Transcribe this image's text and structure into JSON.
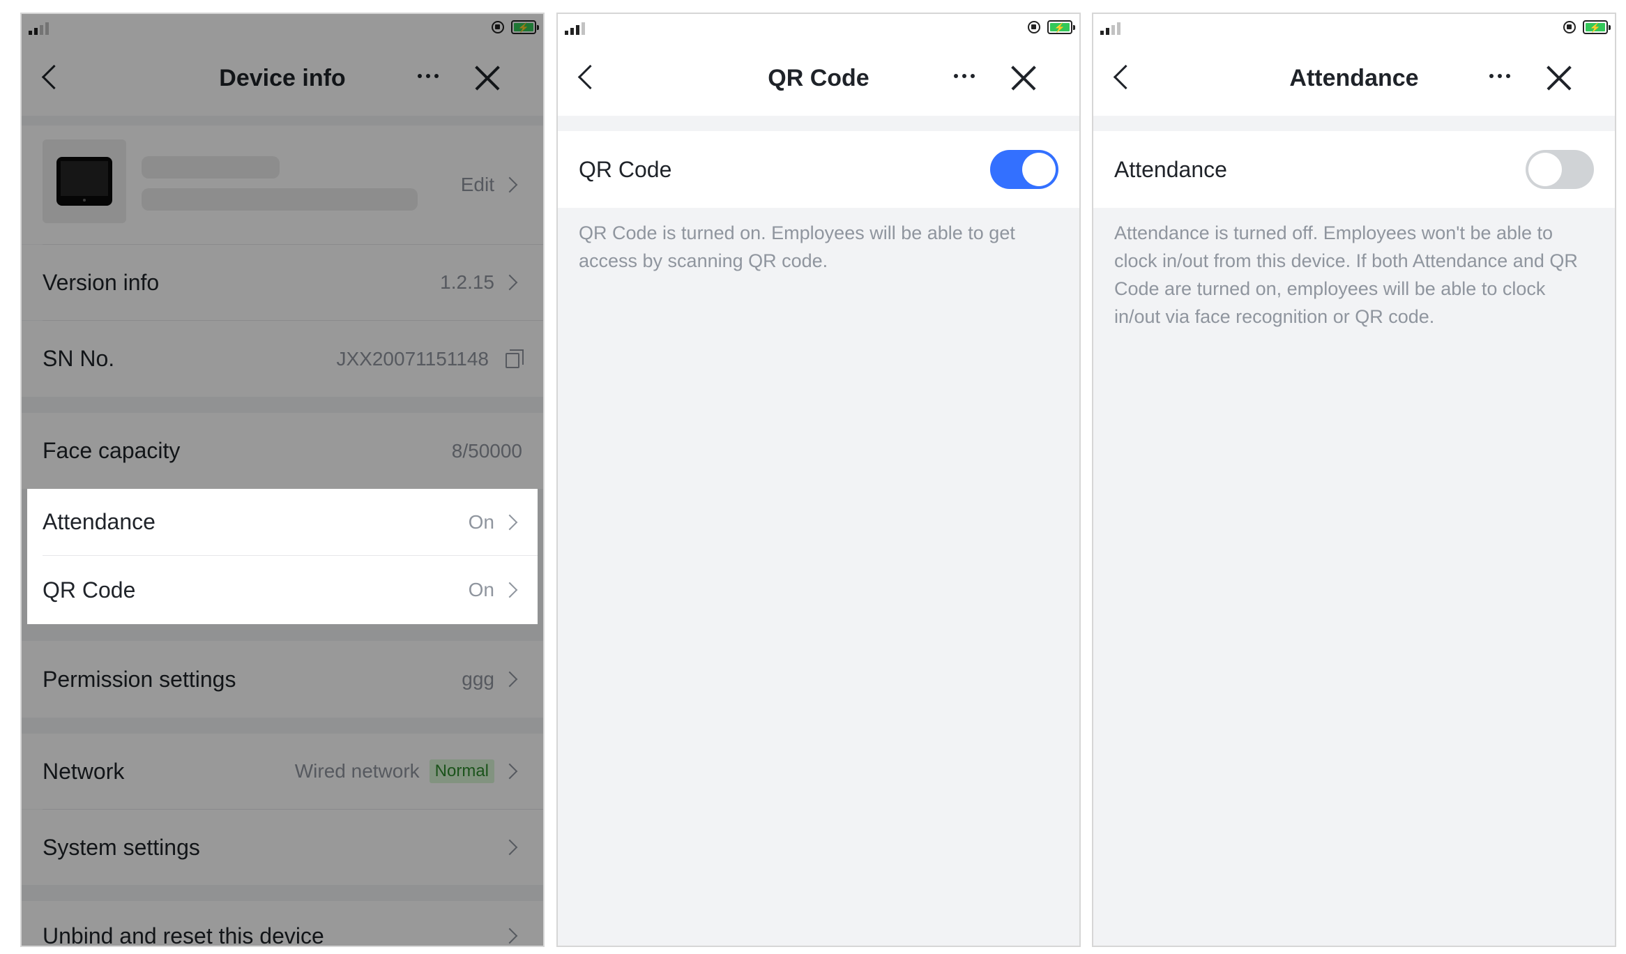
{
  "screen1": {
    "title": "Device info",
    "device": {
      "edit_label": "Edit"
    },
    "version": {
      "label": "Version info",
      "value": "1.2.15"
    },
    "sn": {
      "label": "SN No.",
      "value": "JXX20071151148"
    },
    "face": {
      "label": "Face capacity",
      "value": "8/50000"
    },
    "attendance": {
      "label": "Attendance",
      "value": "On"
    },
    "qrcode": {
      "label": "QR Code",
      "value": "On"
    },
    "permission": {
      "label": "Permission settings",
      "value": "ggg"
    },
    "network": {
      "label": "Network",
      "value": "Wired network",
      "status": "Normal"
    },
    "system": {
      "label": "System settings"
    },
    "unbind": {
      "label": "Unbind and reset this device"
    }
  },
  "screen2": {
    "title": "QR Code",
    "toggle_label": "QR Code",
    "toggle_on": true,
    "description": "QR Code is turned on. Employees will be able to get access by scanning QR code."
  },
  "screen3": {
    "title": "Attendance",
    "toggle_label": "Attendance",
    "toggle_on": false,
    "description": "Attendance is turned off. Employees won't be able to clock in/out from this device. If both Attendance and QR Code are turned on, employees will be able to clock in/out via face recognition or QR code."
  },
  "colors": {
    "accent": "#3370ff",
    "status_green": "#2e8b2e",
    "status_bg": "#d9f5d6",
    "battery": "#34c759"
  },
  "icons": [
    "signal-icon",
    "rotation-lock-icon",
    "battery-icon",
    "back-icon",
    "more-icon",
    "close-icon",
    "chevron-right-icon",
    "copy-icon"
  ]
}
